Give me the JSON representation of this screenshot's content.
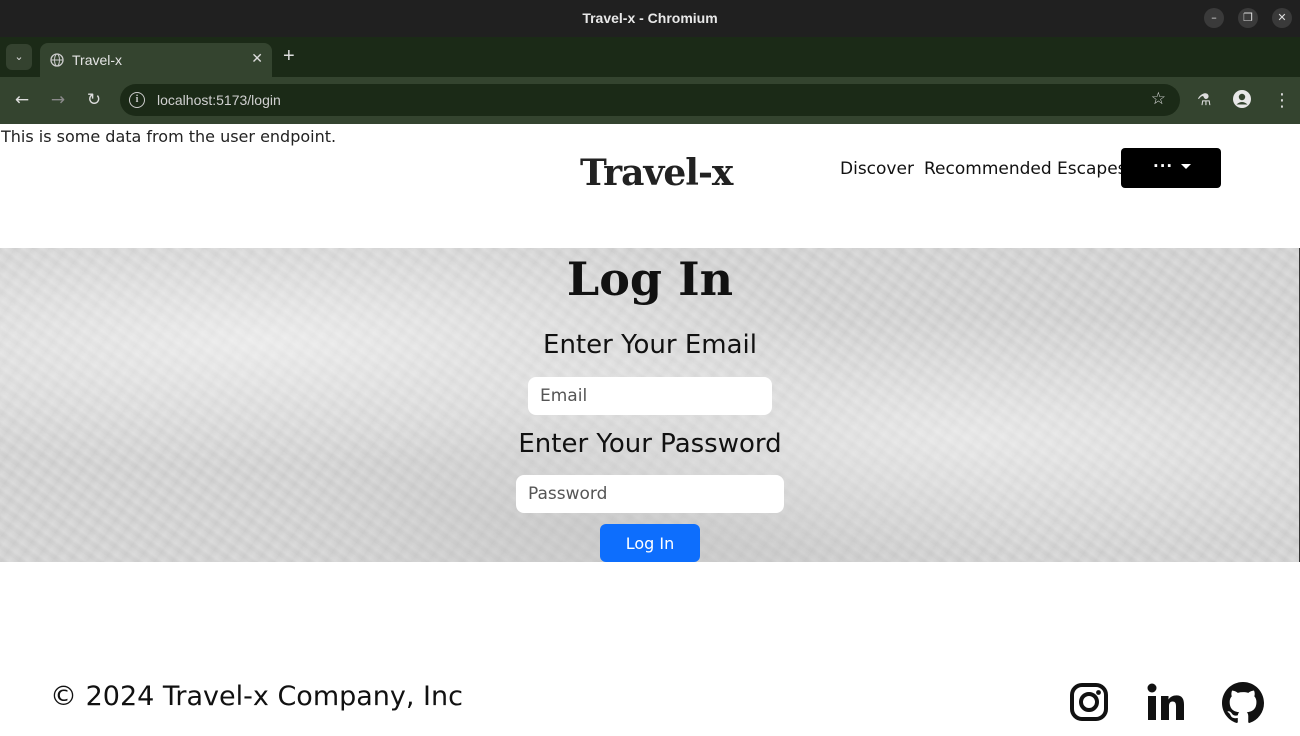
{
  "window": {
    "title": "Travel-x - Chromium",
    "controls": {
      "minimize": "–",
      "restore": "❐",
      "close": "✕"
    }
  },
  "browser": {
    "tab_search_glyph": "⌄",
    "tab": {
      "label": "Travel-x",
      "close_glyph": "✕"
    },
    "new_tab_glyph": "+",
    "toolbar": {
      "back_glyph": "←",
      "forward_glyph": "→",
      "reload_glyph": "↻",
      "info_glyph": "i",
      "url": "localhost:5173/login",
      "star_glyph": "☆",
      "labs_glyph": "⚗",
      "menu_glyph": "⋮"
    }
  },
  "page": {
    "endpoint_text": "This is some data from the user endpoint.",
    "navbar": {
      "logo": "Travel-x",
      "links": [
        "Discover",
        "Recommended Escapes"
      ],
      "dropdown_label": "···"
    },
    "login": {
      "heading": "Log In",
      "email_label": "Enter Your Email",
      "email_placeholder": "Email",
      "email_value": "",
      "password_label": "Enter Your Password",
      "password_placeholder": "Password",
      "password_value": "",
      "submit_label": "Log In"
    },
    "footer": {
      "copyright": "© 2024 Travel-x Company, Inc",
      "social_icons": [
        "instagram-icon",
        "linkedin-icon",
        "github-icon"
      ]
    }
  },
  "colors": {
    "titlebar": "#202020",
    "tabstrip": "#1b2a17",
    "toolbar": "#34442f",
    "login_button": "#0d6efd",
    "dropdown_button": "#000000"
  }
}
